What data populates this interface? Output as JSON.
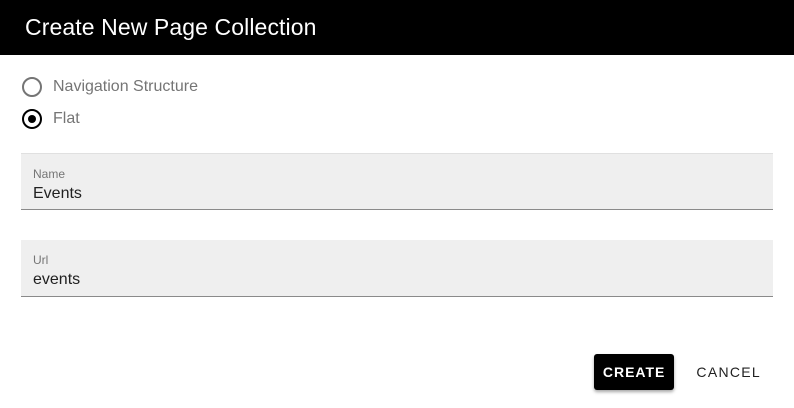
{
  "dialog": {
    "title": "Create New Page Collection"
  },
  "structure_options": {
    "items": [
      {
        "label": "Navigation Structure",
        "checked": false
      },
      {
        "label": "Flat",
        "checked": true
      }
    ]
  },
  "fields": {
    "name": {
      "label": "Name",
      "value": "Events"
    },
    "url": {
      "label": "Url",
      "value": "events"
    }
  },
  "actions": {
    "create_label": "CREATE",
    "cancel_label": "CANCEL"
  },
  "colors": {
    "header_bg": "#000000",
    "primary": "#000000",
    "field_bg": "#efefef"
  }
}
